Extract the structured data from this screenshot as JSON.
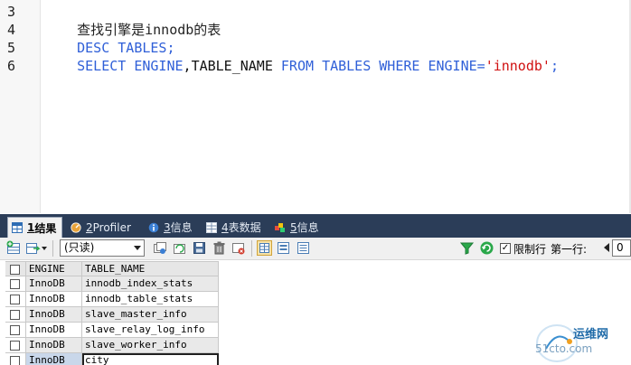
{
  "editor": {
    "line_numbers": [
      "3",
      "4",
      "5",
      "6"
    ],
    "line3_comment": "查找引擎是innodb的表",
    "line4": {
      "desc": "DESC",
      "tables": "TABLES",
      "semi": ";"
    },
    "line5": {
      "select": "SELECT",
      "engine": "ENGINE",
      "comma": ",",
      "table_name": "TABLE_NAME",
      "from": "FROM",
      "tables": "TABLES",
      "where": "WHERE",
      "engine2": "ENGINE",
      "eq": "=",
      "value": "'innodb'",
      "semi": ";"
    }
  },
  "tabs": [
    {
      "num": "1",
      "label": " 结果",
      "icon": "result-grid-icon",
      "active": true
    },
    {
      "num": "2",
      "label": " Profiler",
      "icon": "profiler-icon"
    },
    {
      "num": "3",
      "label": " 信息",
      "icon": "info-icon"
    },
    {
      "num": "4",
      "label": " 表数据",
      "icon": "table-data-icon"
    },
    {
      "num": "5",
      "label": " 信息",
      "icon": "info2-icon"
    }
  ],
  "toolbar": {
    "mode_select": "(只读)",
    "limit_label": "限制行",
    "first_row_label": "第一行:",
    "first_row_value": "0",
    "limit_checked": "✓"
  },
  "grid": {
    "columns": [
      "ENGINE",
      "TABLE_NAME"
    ],
    "rows": [
      [
        "InnoDB",
        "innodb_index_stats"
      ],
      [
        "InnoDB",
        "innodb_table_stats"
      ],
      [
        "InnoDB",
        "slave_master_info"
      ],
      [
        "InnoDB",
        "slave_relay_log_info"
      ],
      [
        "InnoDB",
        "slave_worker_info"
      ],
      [
        "InnoDB",
        "city"
      ]
    ]
  },
  "watermark": {
    "title": "运维网",
    "url": "51cto.com"
  },
  "colors": {
    "keyword": "#3060d8",
    "string": "#d01010",
    "tabbar": "#2b3d58",
    "toolbar": "#f0f0f0"
  }
}
